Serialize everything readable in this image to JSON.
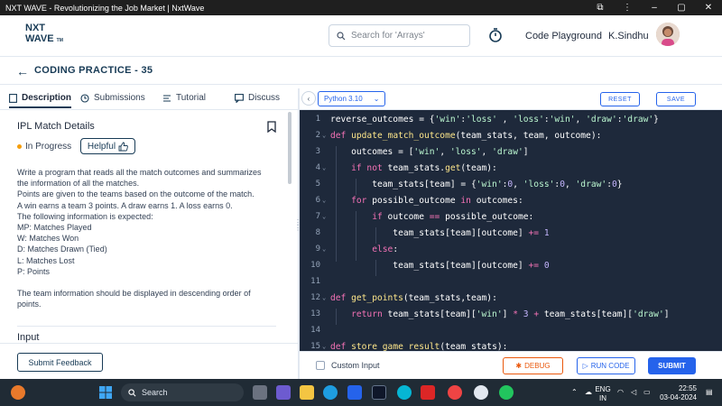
{
  "window": {
    "title": "NXT WAVE - Revolutionizing the Job Market | NxtWave"
  },
  "header": {
    "logo_line1": "NXT",
    "logo_line2": "WAVE",
    "logo_tm": "TM",
    "search_placeholder": "Search for 'Arrays'",
    "code_playground": "Code Playground",
    "user_name": "K.Sindhu"
  },
  "subheader": {
    "title": "CODING PRACTICE - 35"
  },
  "tabs": [
    {
      "label": "Description"
    },
    {
      "label": "Submissions"
    },
    {
      "label": "Tutorial"
    },
    {
      "label": "Discuss"
    }
  ],
  "problem": {
    "title": "IPL Match Details",
    "status": "In Progress",
    "helpful_label": "Helpful",
    "description": [
      "Write a program that reads all the match outcomes and summarizes",
      "the information of all the matches.",
      "Points are given to the teams based on the outcome of the match.",
      "A win earns a team 3 points. A draw earns 1. A loss earns 0.",
      "The following information is expected:",
      "MP: Matches Played",
      "W: Matches Won",
      "D: Matches Drawn (Tied)",
      "L: Matches Lost",
      "P: Points",
      "",
      "The team information should be displayed in descending order of",
      "points."
    ],
    "input_label": "Input",
    "submit_feedback": "Submit Feedback"
  },
  "editor": {
    "language": "Python 3.10",
    "reset_label": "RESET",
    "save_label": "SAVE",
    "line_numbers": [
      "1",
      "2",
      "3",
      "4",
      "5",
      "6",
      "7",
      "8",
      "9",
      "10",
      "11",
      "12",
      "13",
      "14",
      "15"
    ],
    "custom_input_label": "Custom Input",
    "debug_label": "DEBUG",
    "run_label": "RUN CODE",
    "submit_label": "SUBMIT"
  },
  "taskbar": {
    "search_label": "Search",
    "lang_line1": "ENG",
    "lang_line2": "IN",
    "time": "22:55",
    "date": "03-04-2024"
  },
  "colors": {
    "brand": "#183b56",
    "accent": "#2563eb",
    "debug": "#ea580c",
    "editor_bg": "#1e293b"
  }
}
